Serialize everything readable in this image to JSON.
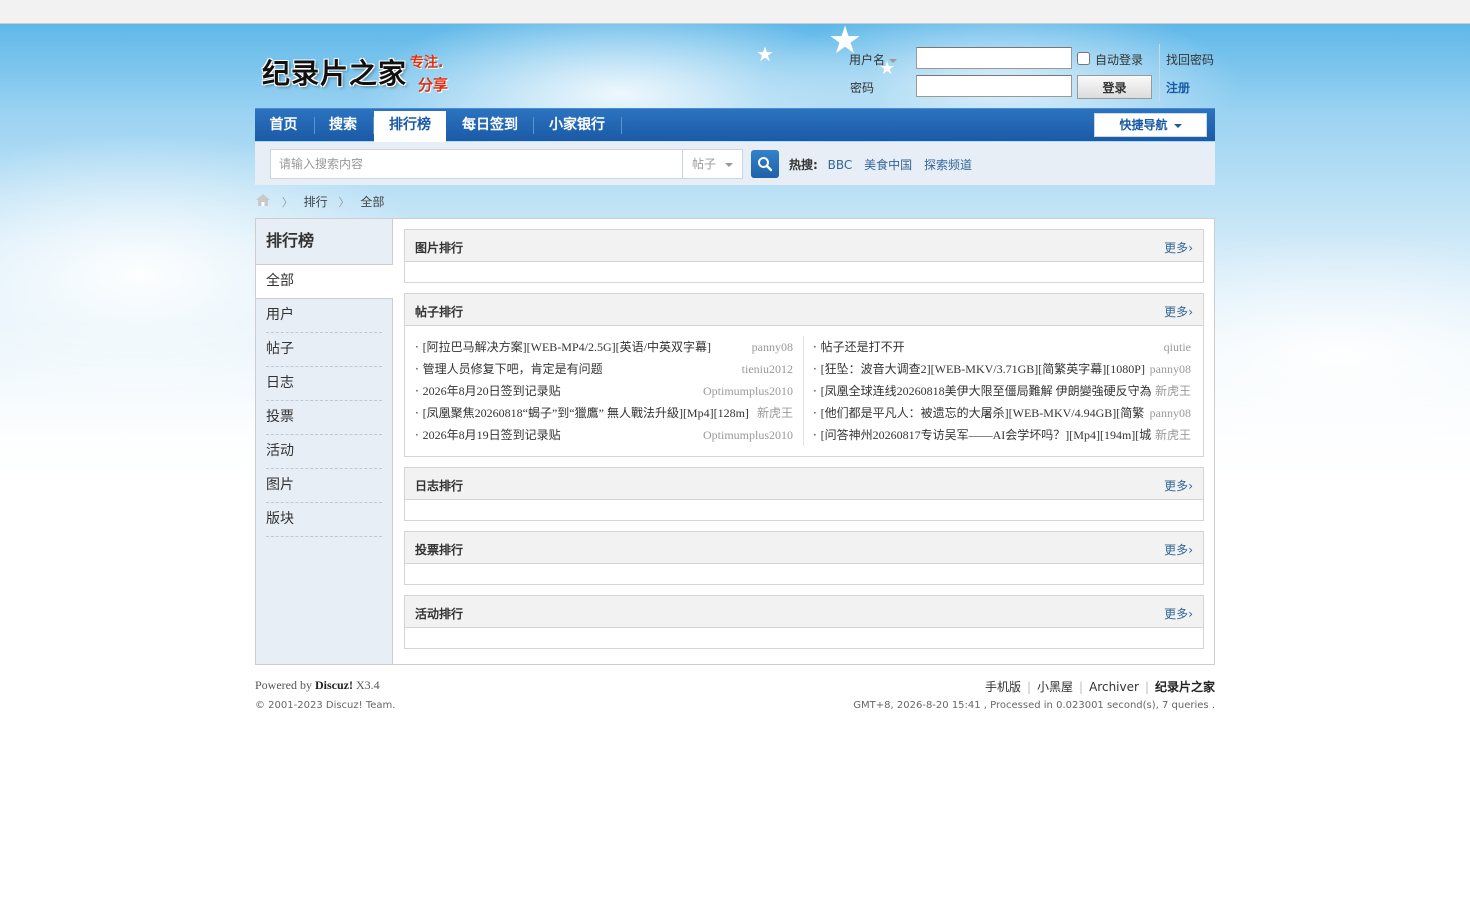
{
  "colors": {
    "nav_bg": "#1b5aa6",
    "link": "#336699",
    "sidebar_bg": "#e8eef6"
  },
  "logo": {
    "main": "纪录片之家",
    "slogan1": "专注.",
    "slogan2": "分享"
  },
  "login": {
    "username_label": "用户名",
    "password_label": "密码",
    "username_value": "",
    "password_value": "",
    "auto_login_label": "自动登录",
    "login_button": "登录",
    "forgot_link": "找回密码",
    "register_link": "注册"
  },
  "nav": {
    "items": [
      {
        "label": "首页"
      },
      {
        "label": "搜索"
      },
      {
        "label": "排行榜"
      },
      {
        "label": "每日签到"
      },
      {
        "label": "小家银行"
      }
    ],
    "active_index": 2,
    "quick_nav": "快捷导航"
  },
  "search": {
    "placeholder": "请输入搜索内容",
    "type": "帖子",
    "hot_label": "热搜:",
    "hot_terms": [
      "BBC",
      "美食中国",
      "探索频道"
    ]
  },
  "breadcrumb": {
    "items": [
      "排行",
      "全部"
    ]
  },
  "sidebar": {
    "title": "排行榜",
    "items": [
      {
        "label": "全部"
      },
      {
        "label": "用户"
      },
      {
        "label": "帖子"
      },
      {
        "label": "日志"
      },
      {
        "label": "投票"
      },
      {
        "label": "活动"
      },
      {
        "label": "图片"
      },
      {
        "label": "版块"
      }
    ]
  },
  "sections": {
    "more": "更多",
    "pictures": {
      "title": "图片排行"
    },
    "posts": {
      "title": "帖子排行",
      "left": [
        {
          "title": "[阿拉巴马解决方案][WEB-MP4/2.5G][英语/中英双字幕]",
          "user": "panny08"
        },
        {
          "title": "管理人员修复下吧，肯定是有问题",
          "user": "tieniu2012"
        },
        {
          "title": "2026年8月20日签到记录贴",
          "user": "Optimumplus2010"
        },
        {
          "title": "[凤凰聚焦20260818“蝎子”到“獵鷹” 無人戰法升級][Mp4][128m]",
          "user": "新虎王"
        },
        {
          "title": "2026年8月19日签到记录贴",
          "user": "Optimumplus2010"
        }
      ],
      "right": [
        {
          "title": "帖子还是打不开",
          "user": "qiutie"
        },
        {
          "title": "[狂坠：波音大调查2][WEB-MKV/3.71GB][简繁英字幕][1080P]",
          "user": "panny08"
        },
        {
          "title": "[凤凰全球连线20260818美伊大限至僵局難解 伊朗變強硬反守為",
          "user": "新虎王"
        },
        {
          "title": "[他们都是平凡人：被遗忘的大屠杀][WEB-MKV/4.94GB][简繁",
          "user": "panny08"
        },
        {
          "title": "[问答神州20260817专访吴军——AI会学坏吗？][Mp4][194m][城",
          "user": "新虎王"
        }
      ]
    },
    "blogs": {
      "title": "日志排行"
    },
    "polls": {
      "title": "投票排行"
    },
    "activities": {
      "title": "活动排行"
    }
  },
  "footer": {
    "powered_prefix": "Powered by",
    "product": "Discuz!",
    "version": "X3.4",
    "copyright": "© 2001-2023 Discuz! Team.",
    "links": [
      "手机版",
      "小黑屋",
      "Archiver"
    ],
    "site_name": "纪录片之家",
    "stats": "GMT+8, 2026-8-20 15:41 , Processed in 0.023001 second(s), 7 queries ."
  }
}
